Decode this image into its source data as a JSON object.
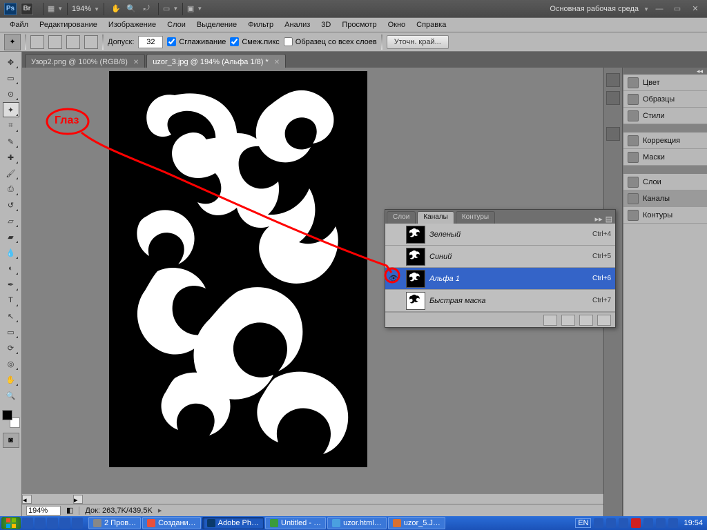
{
  "appbar": {
    "zoom": "194%",
    "workspace_label": "Основная рабочая среда"
  },
  "menu": [
    "Файл",
    "Редактирование",
    "Изображение",
    "Слои",
    "Выделение",
    "Фильтр",
    "Анализ",
    "3D",
    "Просмотр",
    "Окно",
    "Справка"
  ],
  "options": {
    "tolerance_label": "Допуск:",
    "tolerance_value": "32",
    "antialias": "Сглаживание",
    "contiguous": "Смеж.пикс",
    "sample_all": "Образец со всех слоев",
    "refine_btn": "Уточн. край..."
  },
  "doc_tabs": [
    {
      "title": "Узор2.png @ 100% (RGB/8)",
      "active": false
    },
    {
      "title": "uzor_3.jpg @ 194% (Альфа 1/8) *",
      "active": true
    }
  ],
  "channels_panel": {
    "tabs": [
      "Слои",
      "Каналы",
      "Контуры"
    ],
    "rows": [
      {
        "name": "Зеленый",
        "shortcut": "Ctrl+4",
        "eye": false,
        "selected": false,
        "fill": "#00ff00"
      },
      {
        "name": "Синий",
        "shortcut": "Ctrl+5",
        "eye": false,
        "selected": false,
        "fill": "#0000ff"
      },
      {
        "name": "Альфа 1",
        "shortcut": "Ctrl+6",
        "eye": true,
        "selected": true,
        "fill": "#ffffff",
        "bg": "#000"
      },
      {
        "name": "Быстрая маска",
        "shortcut": "Ctrl+7",
        "eye": false,
        "selected": false,
        "fill": "#ffffff",
        "bg": "#000"
      }
    ]
  },
  "right_panels": {
    "group1": [
      "Цвет",
      "Образцы",
      "Стили"
    ],
    "group2": [
      "Коррекция",
      "Маски"
    ],
    "group3": [
      "Слои",
      "Каналы",
      "Контуры"
    ],
    "selected": "Каналы"
  },
  "status": {
    "zoom": "194%",
    "docinfo": "Док: 263,7K/439,5K"
  },
  "annotation": {
    "label": "Глаз"
  },
  "taskbar": {
    "items": [
      {
        "label": "2 Пров…",
        "icon": "#a8c8f8"
      },
      {
        "label": "Создани…",
        "icon": "#e8503c"
      },
      {
        "label": "Adobe Ph…",
        "icon": "#0a3a6b",
        "active": true
      },
      {
        "label": "Untitled - …",
        "icon": "#3a9b3a"
      },
      {
        "label": "uzor.html…",
        "icon": "#4aa0e0"
      },
      {
        "label": "uzor_5.J…",
        "icon": "#d87030"
      }
    ],
    "lang": "EN",
    "time": "19:54"
  }
}
